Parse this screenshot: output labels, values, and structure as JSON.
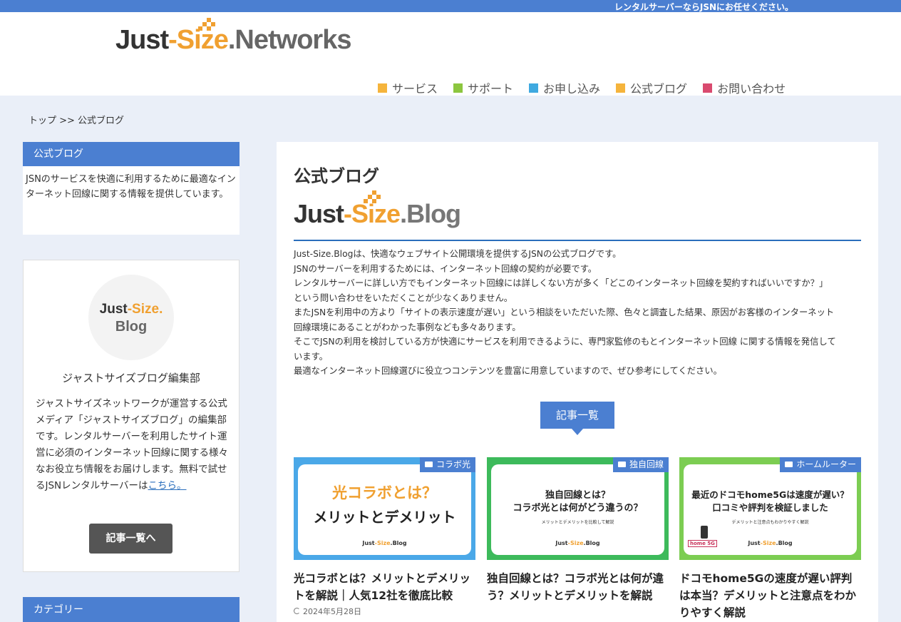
{
  "topbar": {
    "text": "レンタルサーバーならJSNにお任せください。"
  },
  "header": {
    "logo_dark": "Just",
    "logo_orange": "-Size",
    "logo_gray": ".Networks"
  },
  "gnav": [
    {
      "label": "サービス",
      "color": "#f5b43c"
    },
    {
      "label": "サポート",
      "color": "#8cc63f"
    },
    {
      "label": "お申し込み",
      "color": "#3fa9e0"
    },
    {
      "label": "公式ブログ",
      "color": "#f5b43c"
    },
    {
      "label": "お問い合わせ",
      "color": "#d94a6f"
    }
  ],
  "breadcrumb": "トップ >> 公式ブログ",
  "sidebar": {
    "about_title": "公式ブログ",
    "about_text": "JSNのサービスを快適に利用するために最適なインターネット回線に関する情報を提供しています。",
    "avatar_line1_dark": "Just",
    "avatar_line1_orange": "-Size.",
    "avatar_line2": "Blog",
    "profile_name": "ジャストサイズブログ編集部",
    "profile_desc": "ジャストサイズネットワークが運営する公式メディア「ジャストサイズブログ」の編集部です。レンタルサーバーを利用したサイト運営に必須のインターネット回線に関する様々なお役立ち情報をお届けします。無料で試せるJSNレンタルサーバーは",
    "profile_link": "こちら。",
    "profile_button": "記事一覧へ",
    "category_title": "カテゴリー"
  },
  "main": {
    "title": "公式ブログ",
    "blog_logo_dark": "Just",
    "blog_logo_orange": "-Size",
    "blog_logo_gray": ".Blog",
    "intro": [
      "Just-Size.Blogは、快適なウェブサイト公開環境を提供するJSNの公式ブログです。",
      "JSNのサーバーを利用するためには、インターネット回線の契約が必要です。",
      "レンタルサーバーに詳しい方でもインターネット回線には詳しくない方が多く「どこのインターネット回線を契約すればいいですか？」",
      "という問い合わせをいただくことが少なくありません。",
      "またJSNを利用中の方より「サイトの表示速度が遅い」という相談をいただいた際、色々と調査した結果、原因がお客様のインターネット",
      "回線環境にあることがわかった事例なども多々あります。",
      "そこでJSNの利用を検討している方が快適にサービスを利用できるように、専門家監修のもとインターネット回線 に関する情報を発信して",
      "います。",
      "最適なインターネット回線選びに役立つコンテンツを豊富に用意していますので、ぜひ参考にしてください。"
    ],
    "list_button": "記事一覧"
  },
  "cards": [
    {
      "tag": "コラボ光",
      "tag_color": "#4b7fd1",
      "frame_color": "#4aa8e8",
      "thumb_line1": "光コラボとは？",
      "thumb_line2": "メリットとデメリット",
      "thumb_sub": "",
      "title": "光コラボとは？メリットとデメリットを解説｜人気12社を徹底比較",
      "date": "2024年5月28日"
    },
    {
      "tag": "独自回線",
      "tag_color": "#4b7fd1",
      "frame_color": "#3dba5b",
      "thumb_line1": "独自回線とは？",
      "thumb_line2": "コラボ光とは何がどう違うの？",
      "thumb_sub": "メリットとデメリットを比較して解説",
      "title": "独自回線とは？コラボ光とは何が違う？メリットとデメリットを解説",
      "date": ""
    },
    {
      "tag": "ホームルーター",
      "tag_color": "#4b7fd1",
      "frame_color": "#7ccd52",
      "thumb_line1": "最近のドコモhome5Gは速度が遅い？",
      "thumb_line2": "口コミや評判を検証しました",
      "thumb_sub": "デメリットと注意点もわかりやすく解説",
      "thumb_badge": "home 5G",
      "title": "ドコモhome5Gの速度が遅い評判は本当？デメリットと注意点をわかりやすく解説",
      "date": ""
    }
  ],
  "thumb_brand_dark": "Just",
  "thumb_brand_orange": "-Size",
  "thumb_brand_gray": ".Blog"
}
